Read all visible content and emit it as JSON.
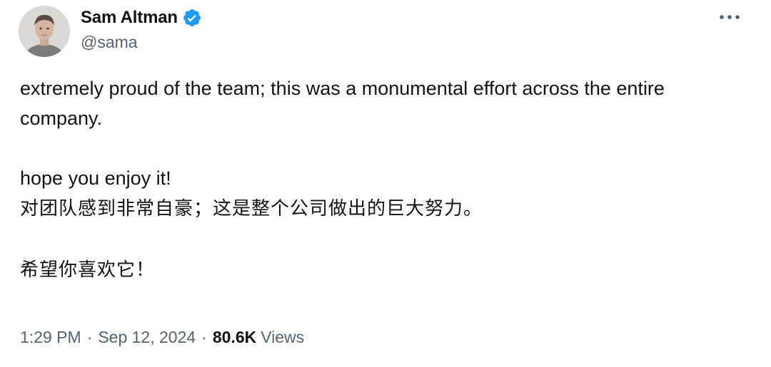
{
  "author": {
    "display_name": "Sam Altman",
    "handle": "@sama",
    "verified": true,
    "verified_color": "#1d9bf0"
  },
  "icons": {
    "verified": "verified-badge-icon",
    "more": "more-horizontal-icon"
  },
  "tweet": {
    "lines_en": [
      "extremely proud of the team; this was a monumental effort across the entire company.",
      "hope you enjoy it!"
    ],
    "lines_zh": [
      "对团队感到非常自豪；这是整个公司做出的巨大努力。",
      "希望你喜欢它！"
    ]
  },
  "meta": {
    "time": "1:29 PM",
    "separator": "·",
    "date": "Sep 12, 2024",
    "views_count": "80.6K",
    "views_label": "Views"
  },
  "colors": {
    "text_primary": "#0f1419",
    "text_secondary": "#536471",
    "accent": "#1d9bf0"
  }
}
